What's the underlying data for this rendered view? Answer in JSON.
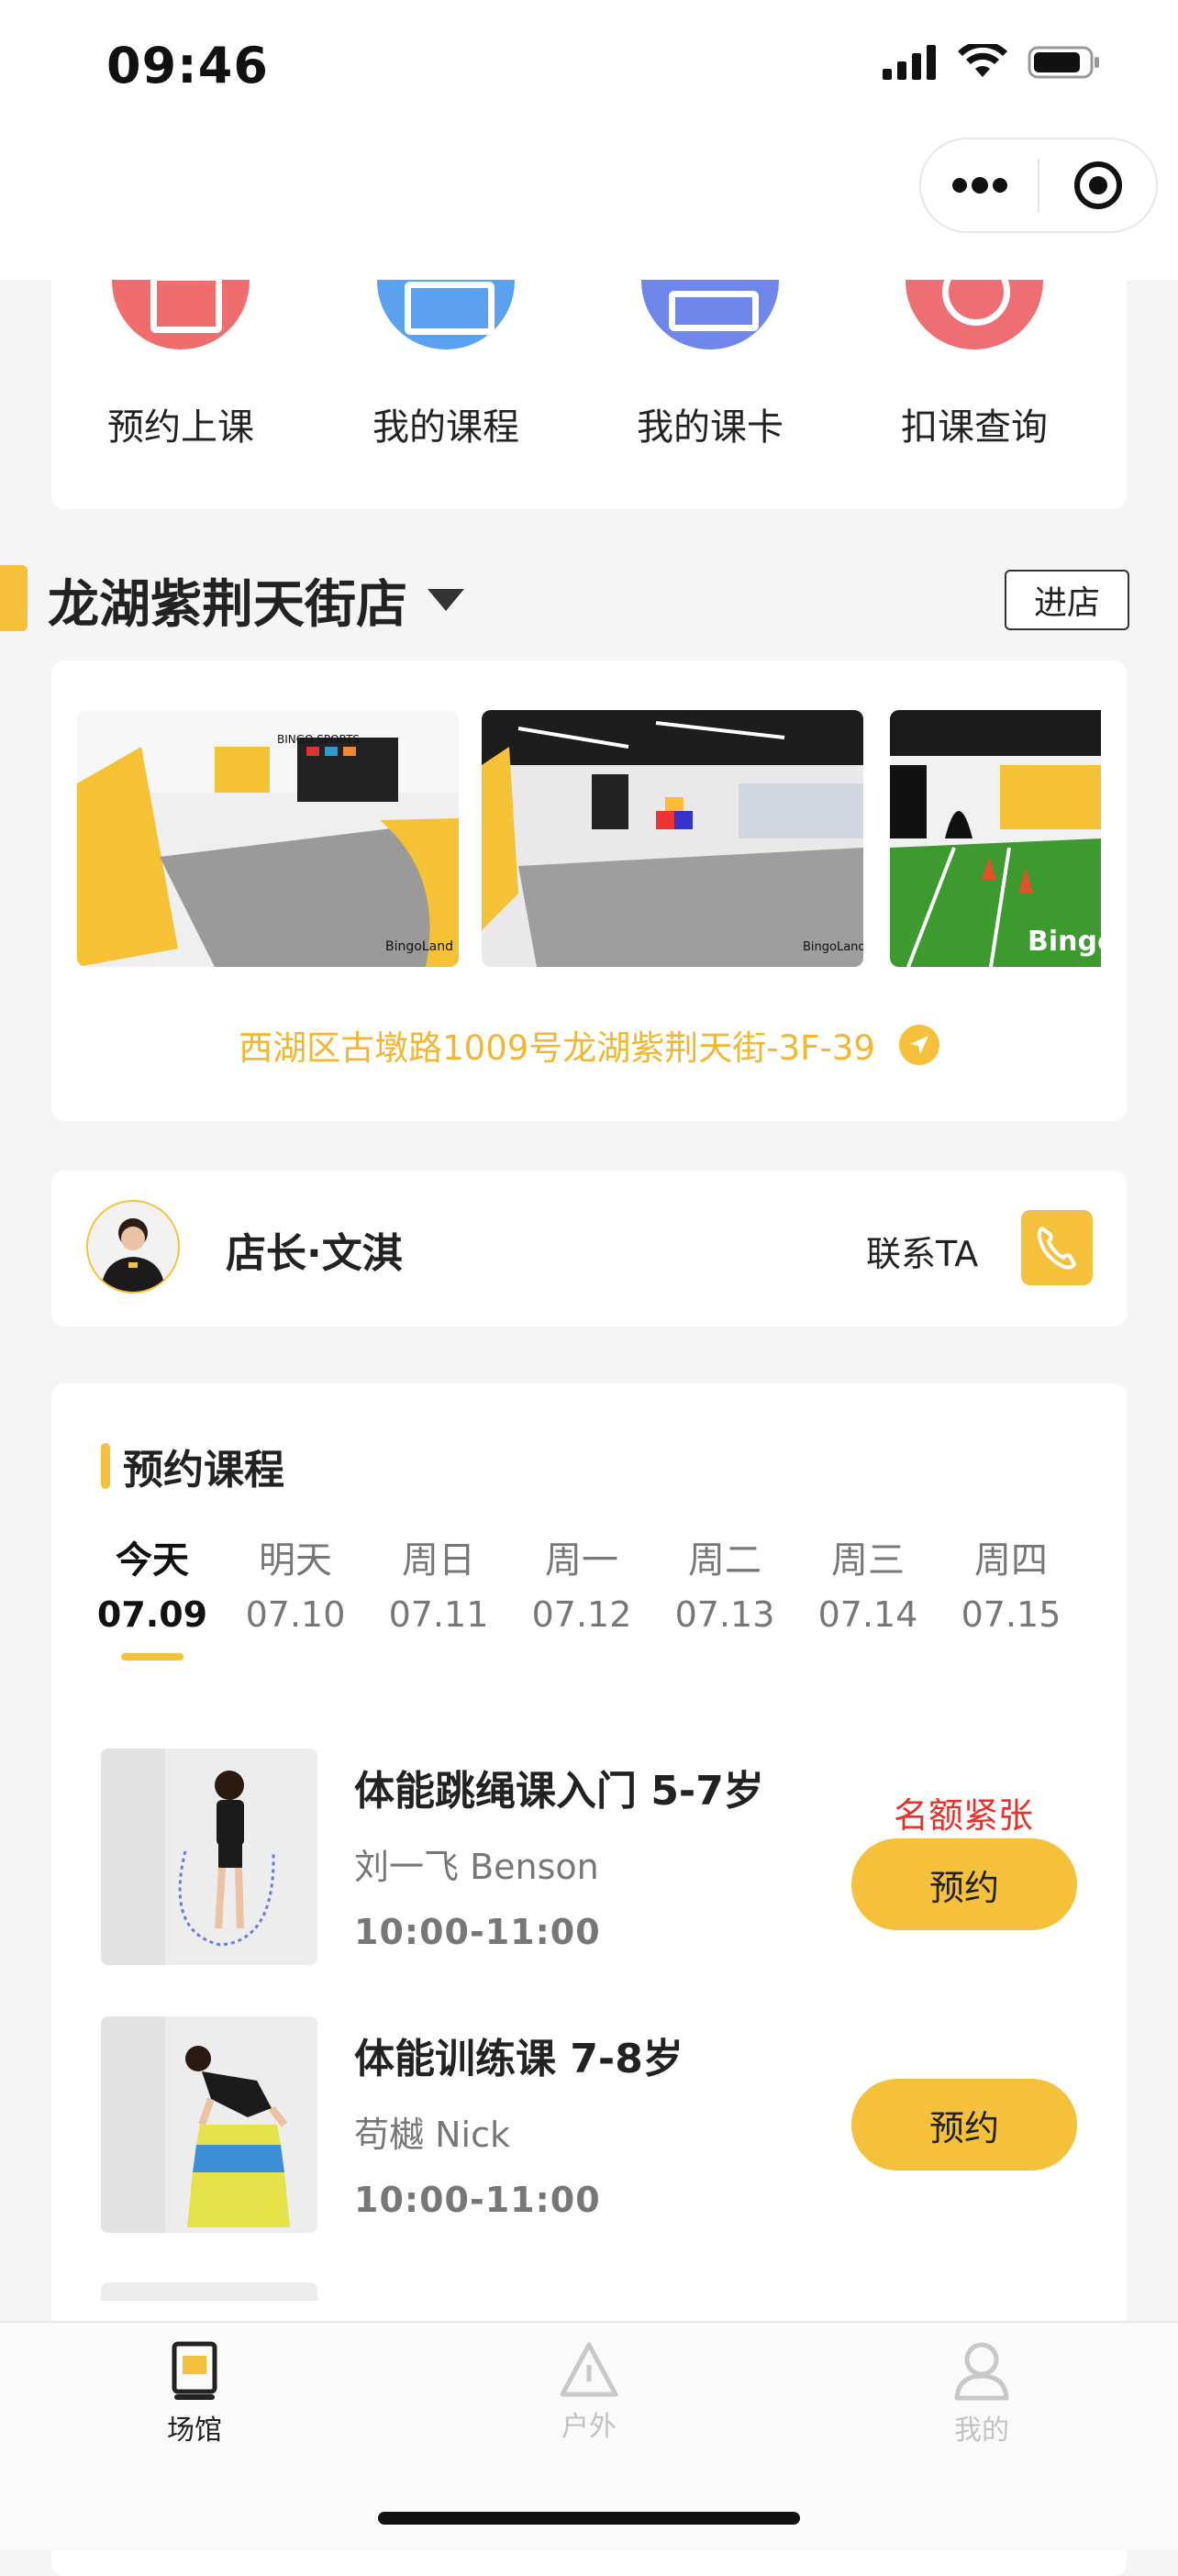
{
  "status_bar": {
    "time": "09:46"
  },
  "capsule": {
    "more_icon": "more-dots-icon",
    "close_icon": "target-close-icon"
  },
  "quick_actions": [
    {
      "label": "预约上课",
      "icon": "calendar-icon",
      "color": "#ef6d6d"
    },
    {
      "label": "我的课程",
      "icon": "course-card-icon",
      "color": "#5aa2ef"
    },
    {
      "label": "我的课卡",
      "icon": "card-icon",
      "color": "#6f86ea"
    },
    {
      "label": "扣课查询",
      "icon": "search-record-icon",
      "color": "#ee6f73"
    }
  ],
  "store": {
    "name": "龙湖紫荆天街店",
    "enter_label": "进店",
    "address": "西湖区古墩路1009号龙湖紫荆天街-3F-39",
    "photo_texts": [
      "BINGO SPORTS",
      "BingoLand",
      "BingoLand",
      "Bingo"
    ]
  },
  "manager": {
    "name": "店长·文淇",
    "contact_label": "联系TA"
  },
  "booking": {
    "title": "预约课程",
    "days": [
      {
        "weekday": "今天",
        "date": "07.09",
        "active": true
      },
      {
        "weekday": "明天",
        "date": "07.10"
      },
      {
        "weekday": "周日",
        "date": "07.11"
      },
      {
        "weekday": "周一",
        "date": "07.12"
      },
      {
        "weekday": "周二",
        "date": "07.13"
      },
      {
        "weekday": "周三",
        "date": "07.14"
      },
      {
        "weekday": "周四",
        "date": "07.15"
      }
    ],
    "courses": [
      {
        "title": "体能跳绳课入门 5-7岁",
        "coach": "刘一飞 Benson",
        "time": "10:00-11:00",
        "tag": "名额紧张",
        "button": "预约"
      },
      {
        "title": "体能训练课 7-8岁",
        "coach": "苟樾 Nick",
        "time": "10:00-11:00",
        "tag": "",
        "button": "预约"
      }
    ]
  },
  "tabbar": {
    "items": [
      {
        "label": "场馆",
        "active": true
      },
      {
        "label": "户外"
      },
      {
        "label": "我的"
      }
    ]
  },
  "colors": {
    "accent": "#f5c03a",
    "address": "#f2b62f",
    "warning": "#e5332a"
  }
}
